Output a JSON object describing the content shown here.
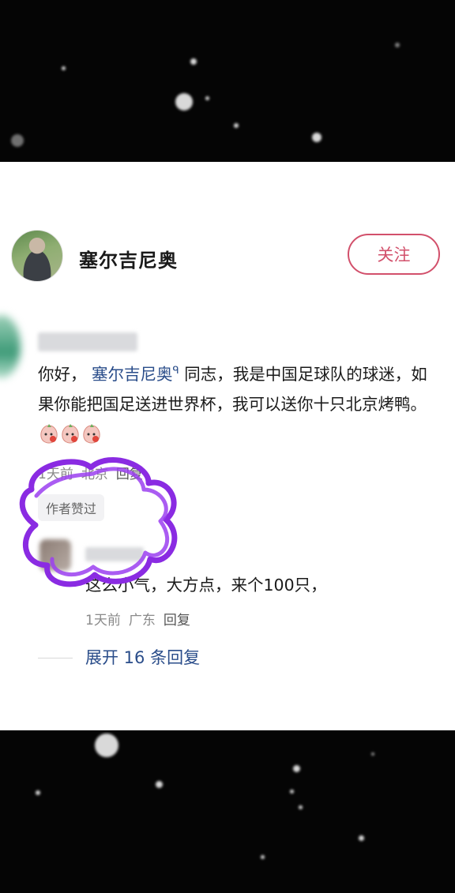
{
  "author": {
    "name": "塞尔吉尼奥",
    "follow_label": "关注"
  },
  "comment": {
    "text_before": "你好，",
    "mention": "塞尔吉尼奥",
    "mention_marker": "ᑫ",
    "text_after": "同志，我是中国足球队的球迷，如果你能把国足送进世界杯，我可以送你十只北京烤鸭。",
    "time": "1天前",
    "location": "北京",
    "reply_label": "回复",
    "liked_badge": "作者赞过"
  },
  "reply": {
    "text": "这么小气，大方点，来个100只，",
    "time": "1天前",
    "location": "广东",
    "reply_label": "回复"
  },
  "expand_label": "展开 16 条回复",
  "colors": {
    "accent": "#d2506b",
    "link": "#2a4d8a",
    "annotation": "#8a2be2"
  }
}
